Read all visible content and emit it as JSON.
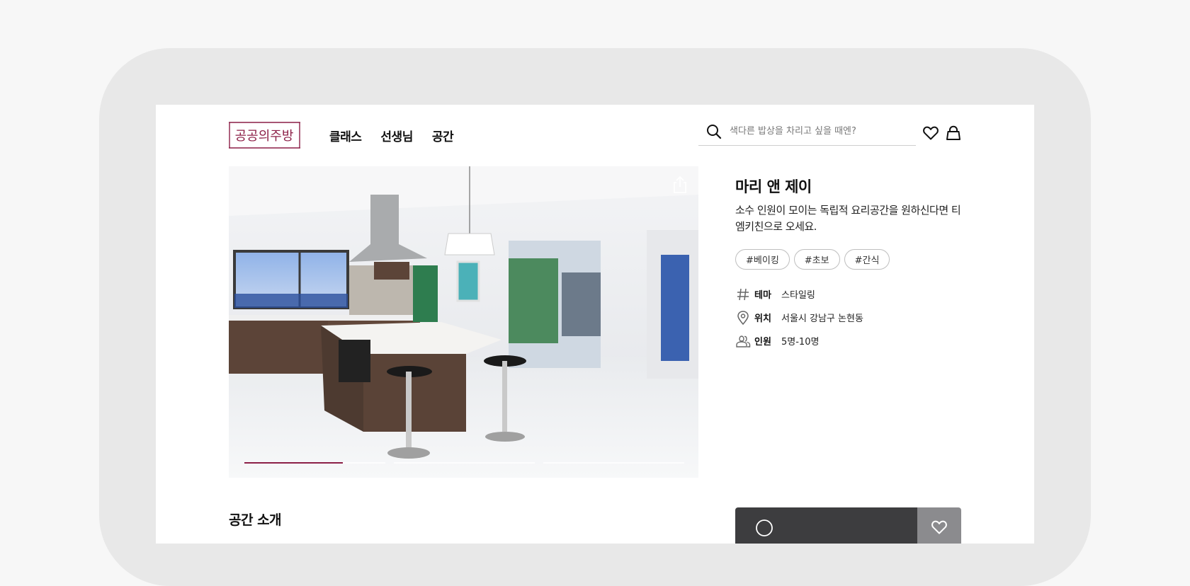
{
  "brand": {
    "logo_text": "공공의주방",
    "accent": "#8c1f47"
  },
  "nav": [
    {
      "label": "클래스"
    },
    {
      "label": "선생님"
    },
    {
      "label": "공간"
    }
  ],
  "search": {
    "placeholder": "색다른 밥상을 차리고 싶을 때엔?",
    "icon": "search-icon"
  },
  "header_icons": [
    "heart-icon",
    "bag-icon"
  ],
  "hero": {
    "image": "modern white kitchen with island and bar stools",
    "share_icon": "share-icon",
    "slides_total": 3,
    "progress": 0.7
  },
  "space": {
    "title": "마리 앤 제이",
    "description": "소수 인원이 모이는 독립적 요리공간을 원하신다면 티엠키친으로 오세요.",
    "tags": [
      "#베이킹",
      "#초보",
      "#간식"
    ],
    "meta": [
      {
        "icon": "hash-icon",
        "key": "테마",
        "value": "스타일링"
      },
      {
        "icon": "location-pin-icon",
        "key": "위치",
        "value": "서울시 강남구 논현동"
      },
      {
        "icon": "people-icon",
        "key": "인원",
        "value": "5명-10명"
      }
    ]
  },
  "section": {
    "title": "공간 소개"
  },
  "cta": {
    "label": "",
    "icon": "chat-icon",
    "wish_icon": "heart-icon"
  },
  "colors": {
    "cta_dark": "#3d3d3f",
    "wish_gray": "#8b8b8e",
    "device_frame": "#e8e8e8"
  }
}
